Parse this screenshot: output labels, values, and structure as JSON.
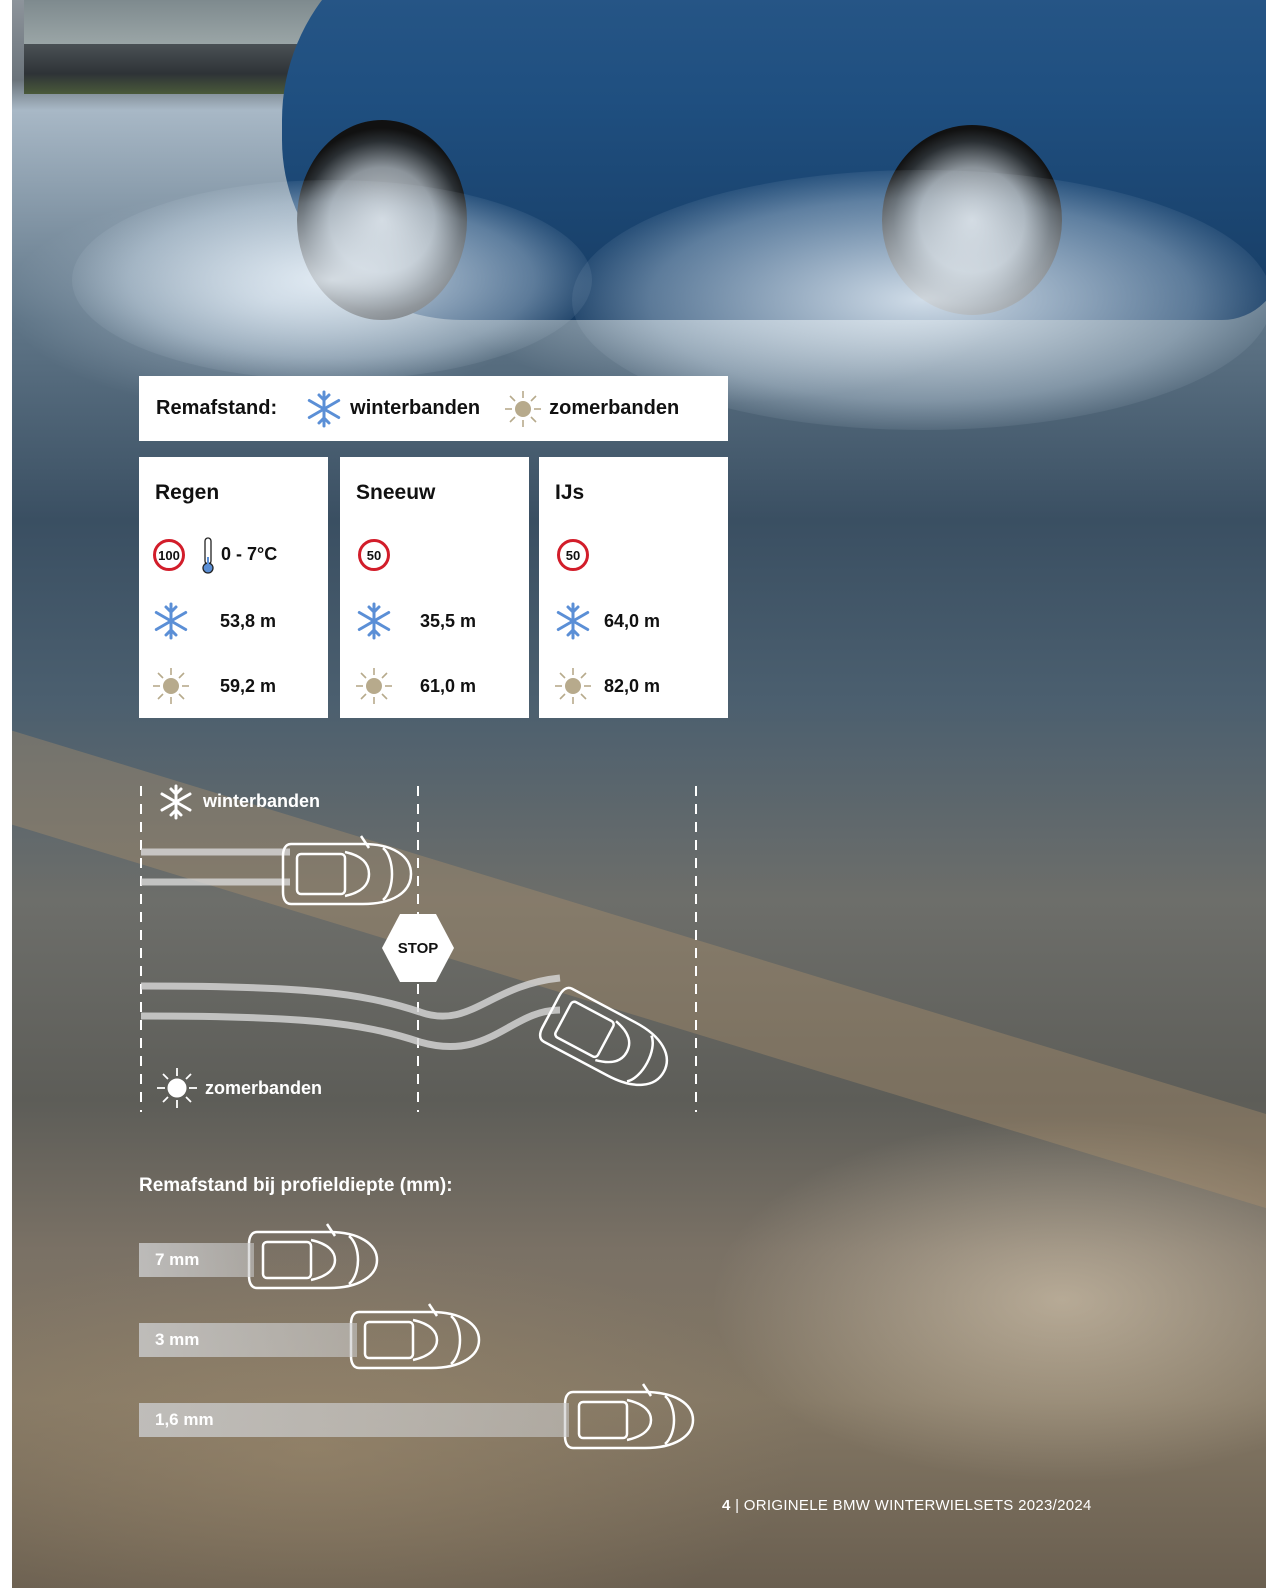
{
  "legend": {
    "title": "Remafstand:",
    "winter_label": "winterbanden",
    "summer_label": "zomerbanden",
    "winter_icon": "snowflake-icon",
    "summer_icon": "sun-icon"
  },
  "cards": [
    {
      "title": "Regen",
      "speed": "100",
      "temp": "0 - 7°C",
      "winter": "53,8 m",
      "summer": "59,2 m"
    },
    {
      "title": "Sneeuw",
      "speed": "50",
      "winter": "35,5 m",
      "summer": "61,0 m"
    },
    {
      "title": "IJs",
      "speed": "50",
      "winter": "64,0 m",
      "summer": "82,0 m"
    }
  ],
  "diagram": {
    "winter_label": "winterbanden",
    "summer_label": "zomerbanden",
    "stop_label": "STOP"
  },
  "tread": {
    "title": "Remafstand bij profieldiepte (mm):",
    "rows": [
      {
        "label": "7 mm"
      },
      {
        "label": "3 mm"
      },
      {
        "label": "1,6 mm"
      }
    ]
  },
  "footer": {
    "page": "4",
    "text": " | ORIGINELE BMW WINTERWIELSETS 2023/2024"
  },
  "colors": {
    "snow": "#5b8fd6",
    "sun": "#b7aa8c",
    "speed_ring": "#d21d2a"
  }
}
